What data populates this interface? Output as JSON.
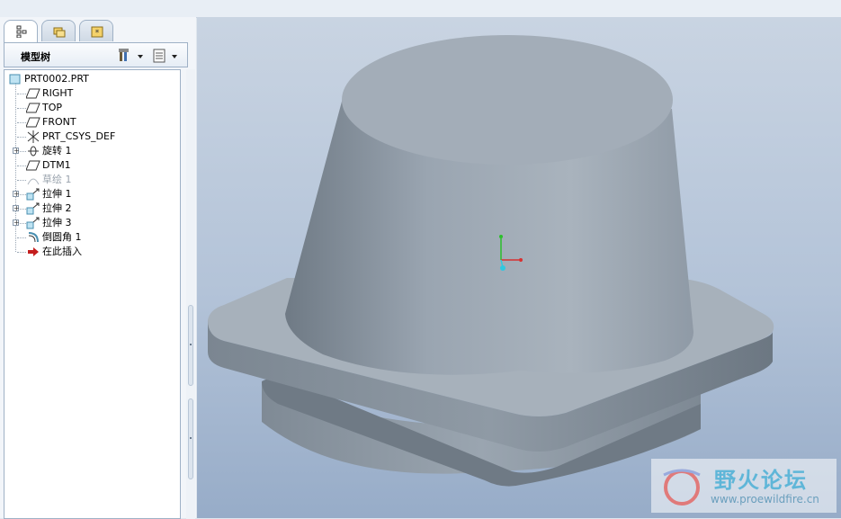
{
  "left_pane": {
    "tabs": [
      {
        "icon": "model-tree-tab-icon",
        "active": true
      },
      {
        "icon": "folder-browser-tab-icon",
        "active": false
      },
      {
        "icon": "favorites-tab-icon",
        "active": false
      }
    ],
    "panel_title": "模型树",
    "tools": [
      {
        "icon": "tree-settings-icon"
      },
      {
        "icon": "tree-columns-icon"
      }
    ],
    "tree": [
      {
        "label": "PRT0002.PRT",
        "icon": "part-icon",
        "level": 0,
        "expandable": false,
        "disabled": false
      },
      {
        "label": "RIGHT",
        "icon": "datum-plane-icon",
        "level": 1,
        "expandable": false,
        "disabled": false
      },
      {
        "label": "TOP",
        "icon": "datum-plane-icon",
        "level": 1,
        "expandable": false,
        "disabled": false
      },
      {
        "label": "FRONT",
        "icon": "datum-plane-icon",
        "level": 1,
        "expandable": false,
        "disabled": false
      },
      {
        "label": "PRT_CSYS_DEF",
        "icon": "coordinate-system-icon",
        "level": 1,
        "expandable": false,
        "disabled": false
      },
      {
        "label": "旋转 1",
        "icon": "revolve-icon",
        "level": 1,
        "expandable": true,
        "disabled": false
      },
      {
        "label": "DTM1",
        "icon": "datum-plane-icon",
        "level": 1,
        "expandable": false,
        "disabled": false
      },
      {
        "label": "草绘 1",
        "icon": "sketch-icon",
        "level": 1,
        "expandable": false,
        "disabled": true
      },
      {
        "label": "拉伸 1",
        "icon": "extrude-icon",
        "level": 1,
        "expandable": true,
        "disabled": false
      },
      {
        "label": "拉伸 2",
        "icon": "extrude-icon",
        "level": 1,
        "expandable": true,
        "disabled": false
      },
      {
        "label": "拉伸 3",
        "icon": "extrude-icon",
        "level": 1,
        "expandable": true,
        "disabled": false
      },
      {
        "label": "倒圆角 1",
        "icon": "round-icon",
        "level": 1,
        "expandable": false,
        "disabled": false
      },
      {
        "label": "在此插入",
        "icon": "insert-here-arrow-icon",
        "level": 1,
        "expandable": false,
        "disabled": false
      }
    ]
  },
  "viewport": {
    "model": "revolved-cone-on-square-flange",
    "axes_triad": [
      "x-axis-red",
      "y-axis-green",
      "z-axis-cyan"
    ]
  },
  "watermark": {
    "title": "野火论坛",
    "url": "www.proewildfire.cn"
  },
  "colors": {
    "accent": "#9fb1c6",
    "viewport_top": "#c9d4e2",
    "viewport_bottom": "#97acc8",
    "model": "#9aa6b2"
  }
}
